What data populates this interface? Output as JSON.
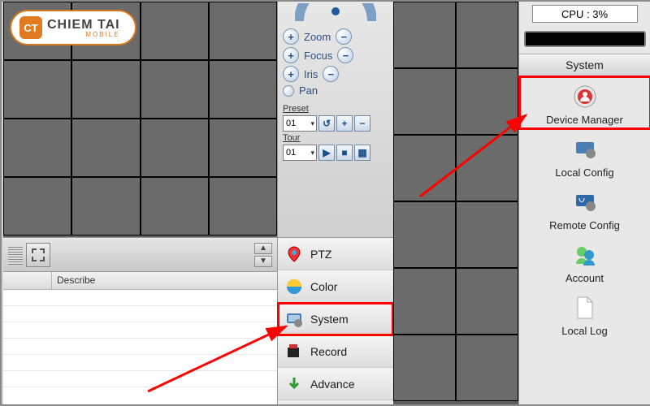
{
  "logo": {
    "mark": "CT",
    "text": "CHIEM TAI",
    "sub": "MOBILE"
  },
  "ptz": {
    "steps": [
      {
        "btn": "+",
        "label": "Zoom",
        "btn2": "−"
      },
      {
        "btn": "+",
        "label": "Focus",
        "btn2": "−"
      },
      {
        "btn": "+",
        "label": "Iris",
        "btn2": "−"
      },
      {
        "btn": "•",
        "label": "Pan",
        "btn2": ""
      }
    ],
    "preset": {
      "title": "Preset",
      "value": "01"
    },
    "tour": {
      "title": "Tour",
      "value": "01"
    }
  },
  "menu": {
    "items": [
      {
        "icon": "ptz-icon",
        "label": "PTZ"
      },
      {
        "icon": "color-icon",
        "label": "Color"
      },
      {
        "icon": "system-icon",
        "label": "System"
      },
      {
        "icon": "record-icon",
        "label": "Record"
      },
      {
        "icon": "advance-icon",
        "label": "Advance"
      }
    ]
  },
  "table": {
    "col1": "",
    "col2": "Describe"
  },
  "right": {
    "cpu": "CPU : 3%",
    "section": "System",
    "items": [
      {
        "label": "Device Manager"
      },
      {
        "label": "Local Config"
      },
      {
        "label": "Remote Config"
      },
      {
        "label": "Account"
      },
      {
        "label": "Local Log"
      }
    ]
  }
}
